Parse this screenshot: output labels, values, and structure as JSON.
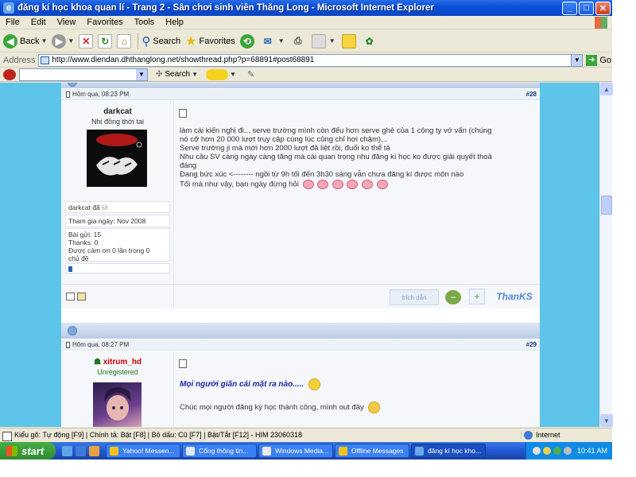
{
  "window": {
    "title": "đăng kí học khoa quan lí - Trang 2 - Sân chơi sinh viên Thăng Long - Microsoft Internet Explorer",
    "controls": [
      "_",
      "□",
      "✕"
    ]
  },
  "menu": [
    "File",
    "Edit",
    "View",
    "Favorites",
    "Tools",
    "Help"
  ],
  "toolbar": {
    "back_label": "Back",
    "search_label": "Search",
    "favorites_label": "Favorites"
  },
  "address": {
    "label": "Address",
    "url": "http://www.diendan.dhthanglong.net/showthread.php?p=68891#post68891",
    "go_label": "Go"
  },
  "searchbar": {
    "search_label": "Search"
  },
  "posts": [
    {
      "date": "Hôm qua, 08:23 PM",
      "number": "#28",
      "username": "darkcat",
      "usertitle": "Nhi đồng thời tai",
      "online_status": "darkcat đã",
      "join_date": "Tham gia ngày: Nov 2008",
      "stats": [
        "Bài gửi: 15",
        "Thanks: 0",
        "Được cảm ơn 0 lần trong 0",
        "chủ đề"
      ],
      "message_lines": [
        "làm cái kiến nghị đi... serve trường mình còn đểu hơn serve ghẻ của 1 công ty vớ vẩn (chúng",
        "nó cỡ hơn 20 000 lượt truy cập cùng lúc cũng chỉ hơi chậm)...",
        "Serve trường ji mà mới hơn 2000 lượt đã liệt rồi, đuối ko thể tả",
        "Nhu cầu SV càng ngày càng tăng mà cái quan trọng nhu đăng kí học ko được giải quyết thoả",
        "đáng",
        "Đang bức xúc <-------- ngồi từ 9h tối đến 3h30 sáng vẫn chưa đăng kí được môn nào",
        "Tối mà như vậy, bạn ngày đừng hỏi"
      ],
      "thanks_button": "ThanKS",
      "quote_button": "trích dẫn"
    },
    {
      "date": "Hôm qua, 08:27 PM",
      "number": "#29",
      "username": "xitrum_hd",
      "usertitle": "Unregistered",
      "subject": "Mọi người giãn cái mặt ra nào.....",
      "message": "Chúc mọi người đăng ký học thành công, mình out đây"
    }
  ],
  "statusbar": {
    "text": "Kiểu gõ: Tự động [F9] | Chính tả: Bật [F8] | Bỏ dấu: Cũ [F7] | Bật/Tắt [F12] - HIM 23060318",
    "zone": "Internet"
  },
  "taskbar": {
    "start_label": "start",
    "tasks": [
      "Yahoo! Messen...",
      "Cổng thông tin...",
      "Windows Media...",
      "Offline Messages",
      "đăng kí học kho..."
    ],
    "clock": "10:41 AM"
  },
  "colors": {
    "page_background": "#5ec4e9",
    "post_bar": "#b9cce6",
    "title_bar": "#0a4fd8",
    "unregistered_name": "#cc0000",
    "subject_color": "#1a2aa8"
  }
}
